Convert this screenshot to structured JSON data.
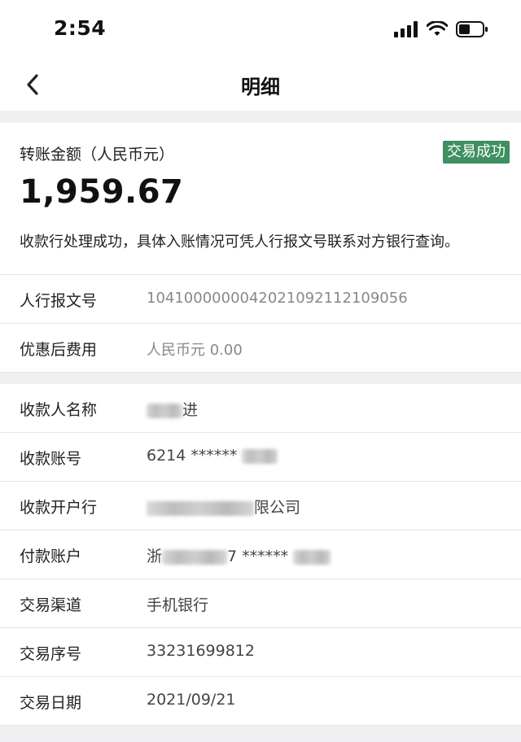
{
  "status": {
    "time": "2:54"
  },
  "nav": {
    "title": "明细"
  },
  "summary": {
    "amount_label": "转账金额（人民币元）",
    "status_badge": "交易成功",
    "amount": "1,959.67",
    "note": "收款行处理成功，具体入账情况可凭人行报文号联系对方银行查询。"
  },
  "fee_section": [
    {
      "label": "人行报文号",
      "value": "1041000000042021092112109056"
    },
    {
      "label": "优惠后费用",
      "value": "人民币元 0.00"
    }
  ],
  "details": {
    "payee_name_label": "收款人名称",
    "payee_name_suffix": "进",
    "payee_account_label": "收款账号",
    "payee_account_prefix": "6214 ******",
    "payee_bank_label": "收款开户行",
    "payee_bank_suffix": "限公司",
    "payer_account_label": "付款账户",
    "payer_account_prefix": "浙",
    "payer_account_mid": "7 ******",
    "channel_label": "交易渠道",
    "channel_value": "手机银行",
    "serial_label": "交易序号",
    "serial_value": "33231699812",
    "date_label": "交易日期",
    "date_value": "2021/09/21"
  },
  "colors": {
    "badge": "#3f8f60",
    "background": "#f0f0f2"
  }
}
